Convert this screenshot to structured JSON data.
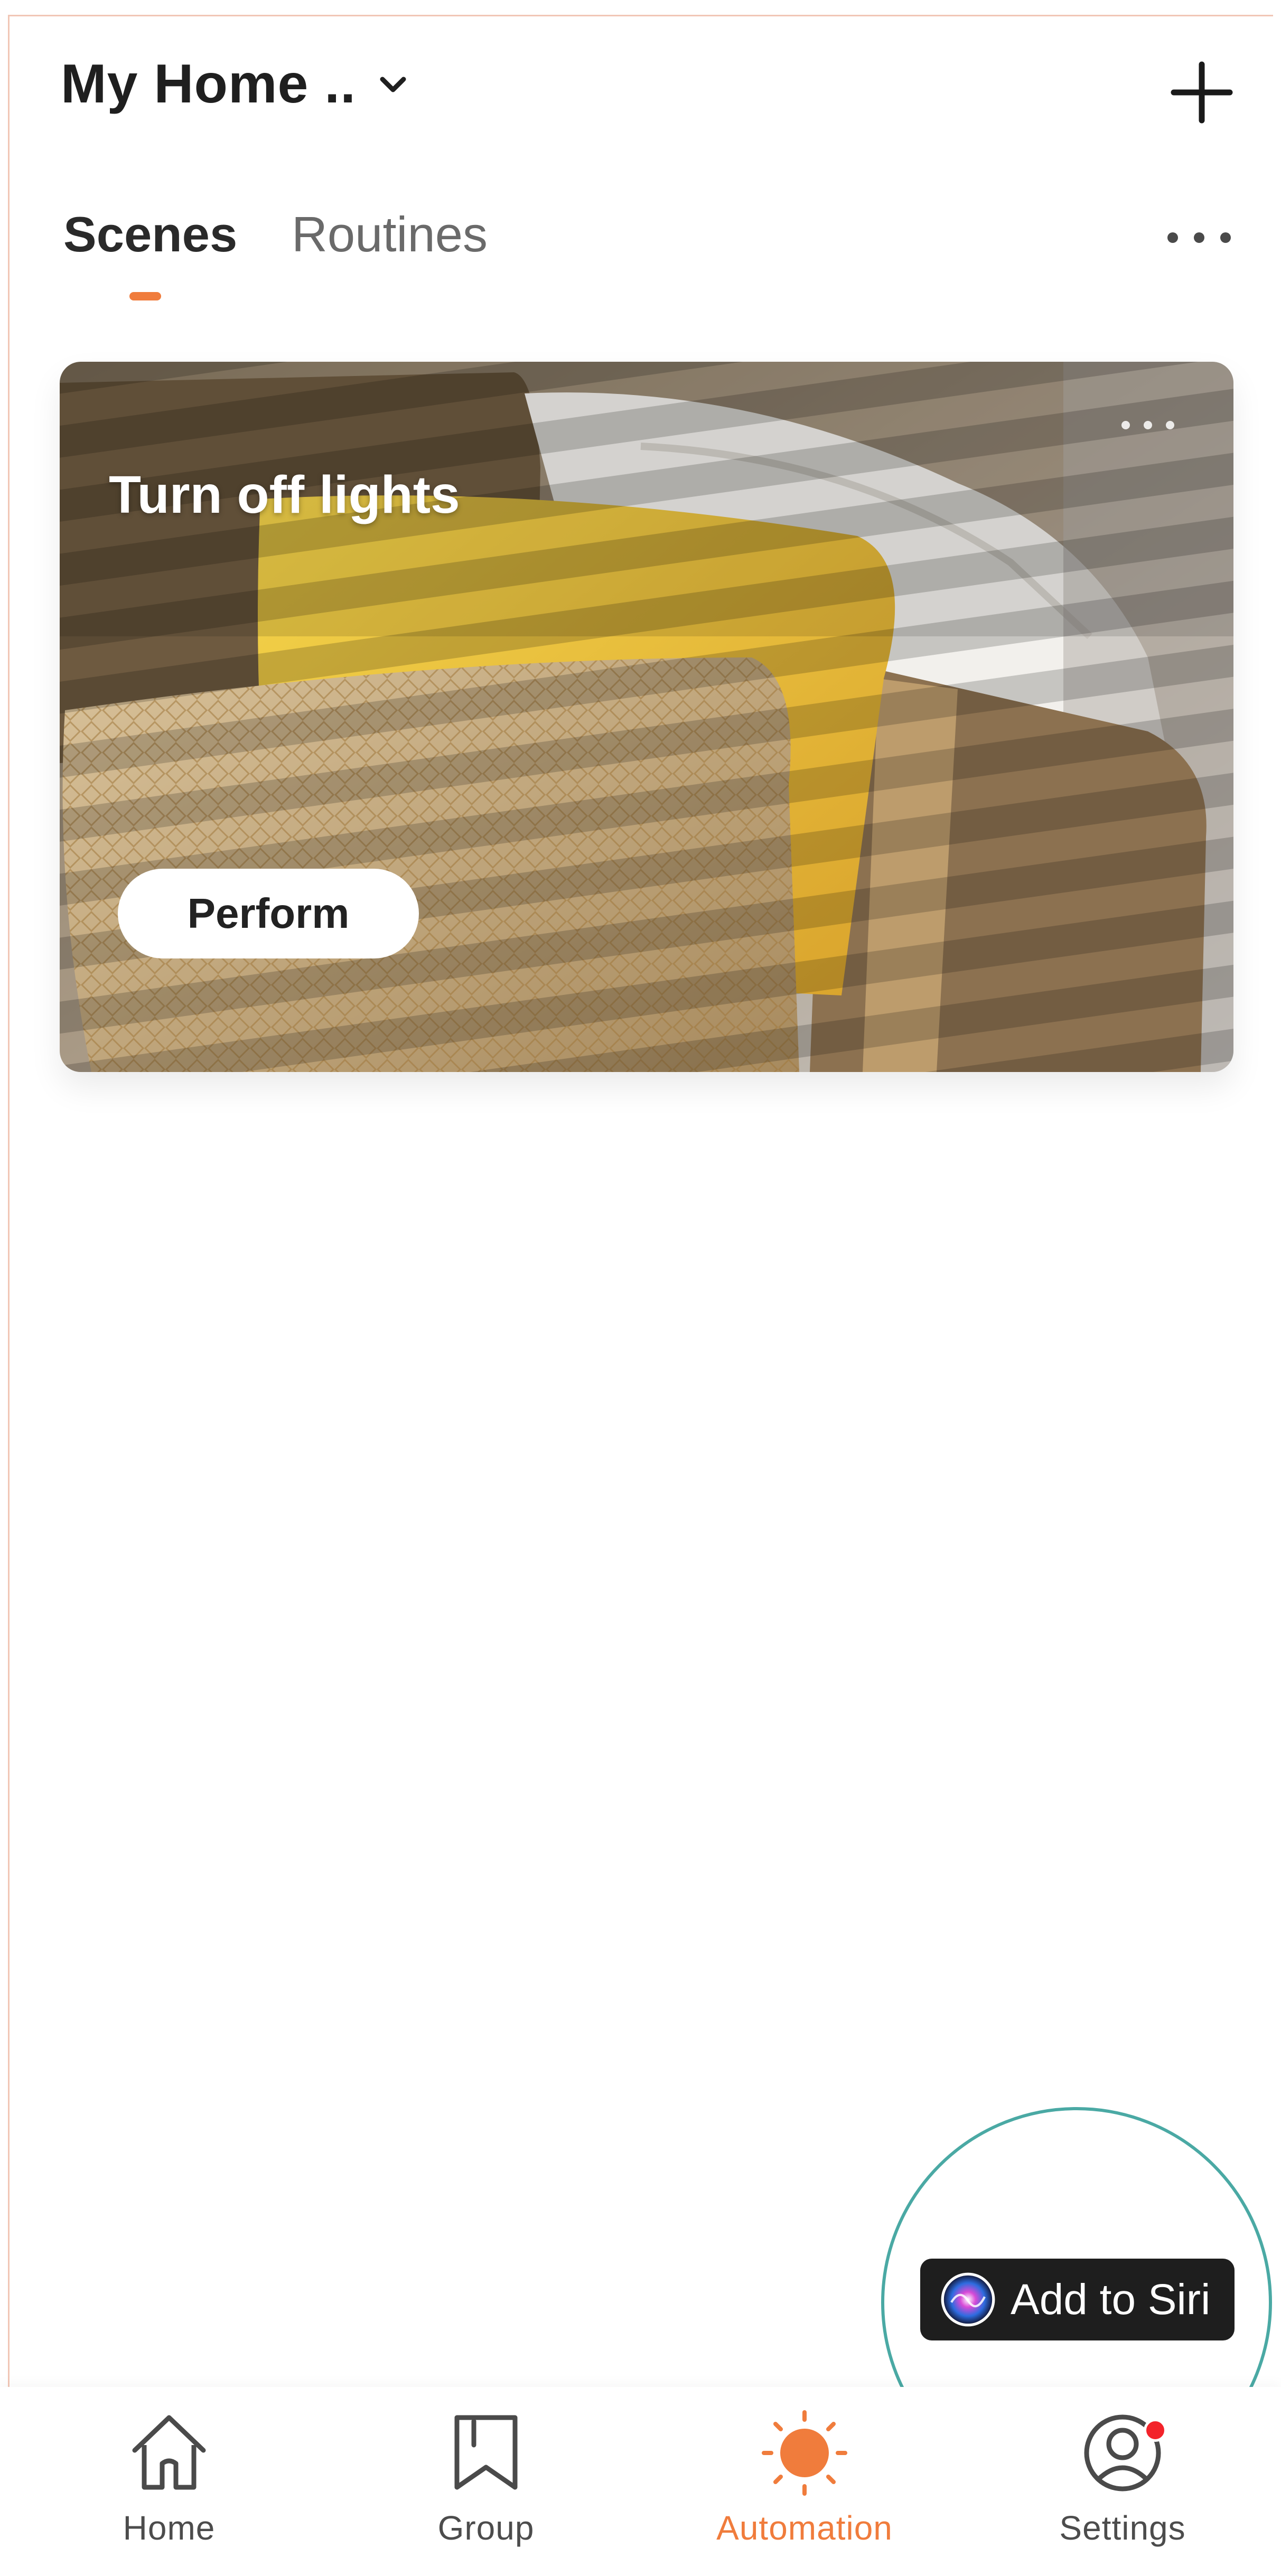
{
  "header": {
    "home_name": "My Home ..",
    "chevron_icon": "chevron-down-icon",
    "add_icon": "plus-icon"
  },
  "tabs": [
    {
      "label": "Scenes",
      "active": true
    },
    {
      "label": "Routines",
      "active": false
    }
  ],
  "more_icon": "more-horizontal-icon",
  "scene_card": {
    "title": "Turn off lights",
    "perform_label": "Perform",
    "more_icon": "more-horizontal-icon"
  },
  "siri": {
    "label": "Add to Siri",
    "icon": "siri-icon"
  },
  "bottom_nav": [
    {
      "label": "Home",
      "icon": "home-icon",
      "active": false
    },
    {
      "label": "Group",
      "icon": "bookmark-icon",
      "active": false
    },
    {
      "label": "Automation",
      "icon": "sun-icon",
      "active": true
    },
    {
      "label": "Settings",
      "icon": "user-circle-icon",
      "active": false,
      "badge": true
    }
  ],
  "colors": {
    "accent": "#f07c3c",
    "badge": "#f3232a",
    "siri_ring": "#4aa9a4",
    "siri_button": "#1e1e1e"
  }
}
